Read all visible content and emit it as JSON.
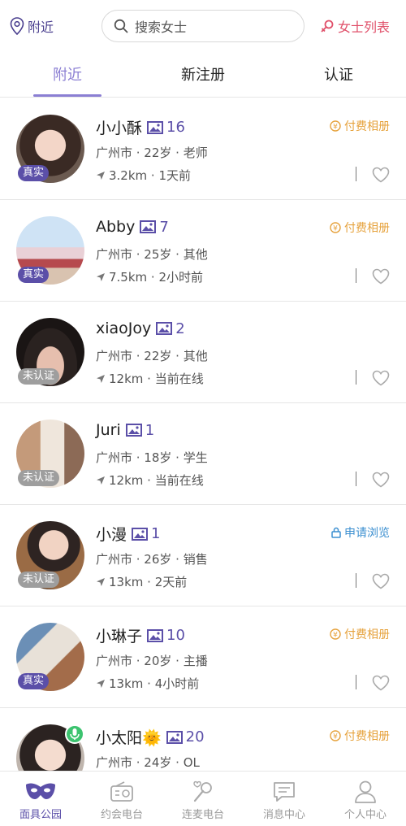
{
  "header": {
    "location_label": "附近",
    "search_placeholder": "搜索女士",
    "ladies_list_label": "女士列表"
  },
  "tabs": [
    {
      "label": "附近"
    },
    {
      "label": "新注册"
    },
    {
      "label": "认证"
    }
  ],
  "users": [
    {
      "name": "小小酥",
      "photos": "16",
      "info": "广州市 · 22岁 · 老师",
      "meta": "3.2km · 1天前",
      "badge": "真实",
      "tag": "付费相册"
    },
    {
      "name": "Abby",
      "photos": "7",
      "info": "广州市 · 25岁 · 其他",
      "meta": "7.5km · 2小时前",
      "badge": "真实",
      "tag": "付费相册"
    },
    {
      "name": "xiaoJoy",
      "photos": "2",
      "info": "广州市 · 22岁 · 其他",
      "meta": "12km · 当前在线",
      "badge": "未认证",
      "tag": ""
    },
    {
      "name": "Juri",
      "photos": "1",
      "info": "广州市 · 18岁 · 学生",
      "meta": "12km · 当前在线",
      "badge": "未认证",
      "tag": ""
    },
    {
      "name": "小漫",
      "photos": "1",
      "info": "广州市 · 26岁 · 销售",
      "meta": "13km · 2天前",
      "badge": "未认证",
      "tag": "申请浏览"
    },
    {
      "name": "小琳子",
      "photos": "10",
      "info": "广州市 · 20岁 · 主播",
      "meta": "13km · 4小时前",
      "badge": "真实",
      "tag": "付费相册"
    },
    {
      "name": "小太阳🌞",
      "photos": "20",
      "info": "广州市 · 24岁 · OL",
      "meta": "",
      "badge": "",
      "tag": "付费相册"
    }
  ],
  "bottom_nav": [
    {
      "label": "面具公园",
      "icon": "mask-icon"
    },
    {
      "label": "约会电台",
      "icon": "radio-icon"
    },
    {
      "label": "连麦电台",
      "icon": "mic-icon"
    },
    {
      "label": "消息中心",
      "icon": "message-icon"
    },
    {
      "label": "个人中心",
      "icon": "person-icon"
    }
  ],
  "colors": {
    "brand": "#5b4fa8",
    "tab_active": "#8b7fd3",
    "paid_tag": "#e6a23c",
    "apply_tag": "#3b8fd0",
    "ladies_link": "#e0506a"
  }
}
